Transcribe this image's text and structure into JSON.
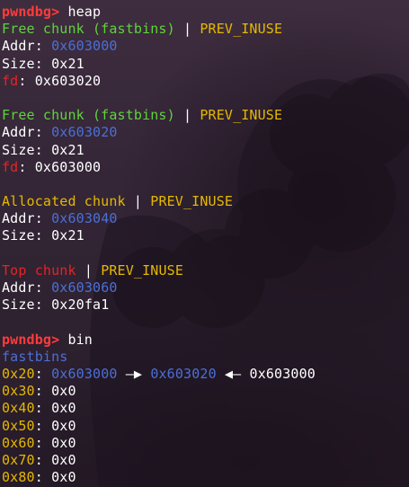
{
  "colors": {
    "prompt": "#ff3b3b",
    "green": "#5fd43a",
    "yellow": "#e6b800",
    "blue": "#4c6fd6",
    "red": "#e02626",
    "text": "#ffffff"
  },
  "prompt": "pwndbg>",
  "cmd_heap": " heap",
  "cmd_bin": " bin",
  "sep": " | ",
  "labels": {
    "addr": "Addr",
    "size": "Size",
    "fd": "fd",
    "colon": ": ",
    "prev_inuse": "PREV_INUSE"
  },
  "chunks": [
    {
      "title": "Free chunk (fastbins)",
      "addr": "0x603000",
      "size": "0x21",
      "fd": "0x603020"
    },
    {
      "title": "Free chunk (fastbins)",
      "addr": "0x603020",
      "size": "0x21",
      "fd": "0x603000"
    },
    {
      "title": "Allocated chunk",
      "addr": "0x603040",
      "size": "0x21"
    },
    {
      "title": "Top chunk",
      "addr": "0x603060",
      "size": "0x20fa1"
    }
  ],
  "fastbins": {
    "title": "fastbins",
    "right_arrow": "—▶",
    "left_arrow": "◀—",
    "entries": [
      {
        "key": "0x20",
        "sep": ": ",
        "v1": "0x603000",
        "v2": "0x603020",
        "v3": "0x603000"
      },
      {
        "key": "0x30",
        "sep": ": ",
        "v": "0x0"
      },
      {
        "key": "0x40",
        "sep": ": ",
        "v": "0x0"
      },
      {
        "key": "0x50",
        "sep": ": ",
        "v": "0x0"
      },
      {
        "key": "0x60",
        "sep": ": ",
        "v": "0x0"
      },
      {
        "key": "0x70",
        "sep": ": ",
        "v": "0x0"
      },
      {
        "key": "0x80",
        "sep": ": ",
        "v": "0x0"
      }
    ]
  }
}
